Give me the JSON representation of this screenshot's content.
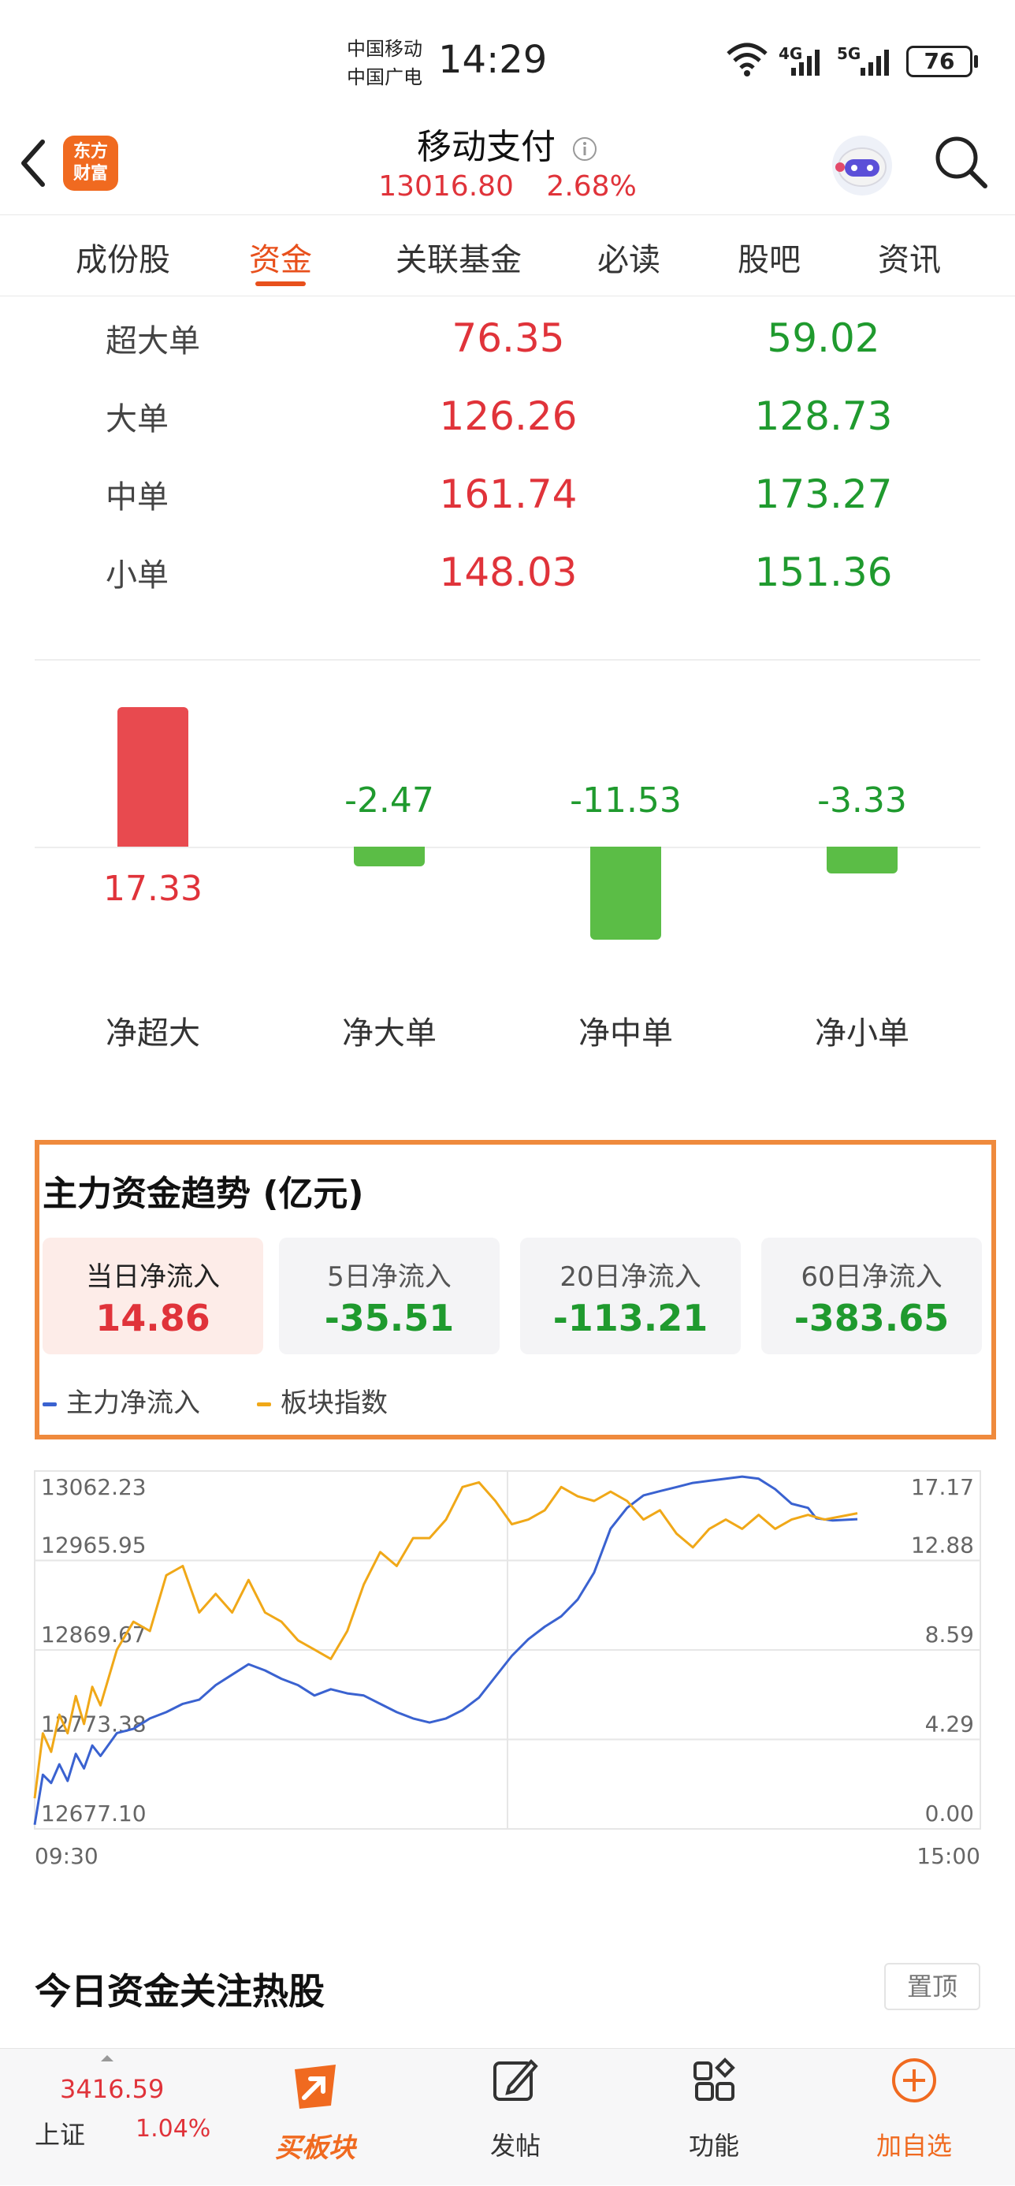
{
  "status_bar": {
    "carrier1": "中国移动",
    "carrier2": "中国广电",
    "time": "14:29",
    "network1": "4G",
    "network2": "5G",
    "battery": "76"
  },
  "header": {
    "logo_line1": "东方",
    "logo_line2": "财富",
    "title": "移动支付",
    "price": "13016.80",
    "change_pct": "2.68%"
  },
  "tabs": [
    {
      "label": "成份股"
    },
    {
      "label": "资金"
    },
    {
      "label": "关联基金"
    },
    {
      "label": "必读"
    },
    {
      "label": "股吧"
    },
    {
      "label": "资讯"
    }
  ],
  "active_tab": "资金",
  "flow_table": [
    {
      "label": "超大单",
      "inflow": "76.35",
      "outflow": "59.02"
    },
    {
      "label": "大单",
      "inflow": "126.26",
      "outflow": "128.73"
    },
    {
      "label": "中单",
      "inflow": "161.74",
      "outflow": "173.27"
    },
    {
      "label": "小单",
      "inflow": "148.03",
      "outflow": "151.36"
    }
  ],
  "net_bars": [
    {
      "label": "净超大",
      "value": 17.33,
      "display": "17.33"
    },
    {
      "label": "净大单",
      "value": -2.47,
      "display": "-2.47"
    },
    {
      "label": "净中单",
      "value": -11.53,
      "display": "-11.53"
    },
    {
      "label": "净小单",
      "value": -3.33,
      "display": "-3.33"
    }
  ],
  "trend": {
    "title": "主力资金趋势 (亿元)",
    "cards": [
      {
        "label": "当日净流入",
        "value": "14.86",
        "color": "#e0333a"
      },
      {
        "label": "5日净流入",
        "value": "-35.51",
        "color": "#1f9a2e"
      },
      {
        "label": "20日净流入",
        "value": "-113.21",
        "color": "#1f9a2e"
      },
      {
        "label": "60日净流入",
        "value": "-383.65",
        "color": "#1f9a2e"
      }
    ],
    "legend_main": "主力净流入",
    "legend_index": "板块指数"
  },
  "chart_data": {
    "type": "line",
    "x_start": "09:30",
    "x_end": "15:00",
    "left_ticks": [
      "13062.23",
      "12965.95",
      "12869.67",
      "12773.38",
      "12677.10"
    ],
    "right_ticks": [
      "17.17",
      "12.88",
      "8.59",
      "4.29",
      "0.00"
    ],
    "left_ylim": [
      12677.1,
      13062.23
    ],
    "right_ylim": [
      0.0,
      17.17
    ],
    "grid": true,
    "series": [
      {
        "name": "主力净流入",
        "axis": "right",
        "color": "#3a62d0",
        "points": [
          [
            0,
            0.2
          ],
          [
            0.01,
            2.6
          ],
          [
            0.02,
            2.2
          ],
          [
            0.03,
            3.1
          ],
          [
            0.04,
            2.3
          ],
          [
            0.05,
            3.6
          ],
          [
            0.06,
            2.9
          ],
          [
            0.07,
            4.0
          ],
          [
            0.08,
            3.5
          ],
          [
            0.1,
            4.6
          ],
          [
            0.12,
            4.8
          ],
          [
            0.14,
            5.3
          ],
          [
            0.16,
            5.6
          ],
          [
            0.18,
            6.0
          ],
          [
            0.2,
            6.2
          ],
          [
            0.22,
            6.9
          ],
          [
            0.24,
            7.4
          ],
          [
            0.26,
            7.9
          ],
          [
            0.28,
            7.6
          ],
          [
            0.3,
            7.2
          ],
          [
            0.32,
            6.9
          ],
          [
            0.34,
            6.4
          ],
          [
            0.36,
            6.7
          ],
          [
            0.38,
            6.5
          ],
          [
            0.4,
            6.4
          ],
          [
            0.42,
            6.0
          ],
          [
            0.44,
            5.6
          ],
          [
            0.46,
            5.3
          ],
          [
            0.48,
            5.1
          ],
          [
            0.5,
            5.3
          ],
          [
            0.52,
            5.7
          ],
          [
            0.54,
            6.3
          ],
          [
            0.56,
            7.3
          ],
          [
            0.58,
            8.3
          ],
          [
            0.6,
            9.1
          ],
          [
            0.62,
            9.7
          ],
          [
            0.64,
            10.2
          ],
          [
            0.66,
            11.0
          ],
          [
            0.68,
            12.3
          ],
          [
            0.7,
            14.4
          ],
          [
            0.72,
            15.4
          ],
          [
            0.74,
            16.0
          ],
          [
            0.76,
            16.2
          ],
          [
            0.78,
            16.4
          ],
          [
            0.8,
            16.6
          ],
          [
            0.82,
            16.7
          ],
          [
            0.84,
            16.8
          ],
          [
            0.86,
            16.9
          ],
          [
            0.88,
            16.8
          ],
          [
            0.9,
            16.3
          ],
          [
            0.92,
            15.6
          ],
          [
            0.94,
            15.4
          ],
          [
            0.95,
            14.9
          ],
          [
            0.97,
            14.8
          ],
          [
            1.0,
            14.86
          ]
        ]
      },
      {
        "name": "板块指数",
        "axis": "left",
        "color": "#f0a818",
        "points": [
          [
            0,
            12710
          ],
          [
            0.01,
            12780
          ],
          [
            0.02,
            12760
          ],
          [
            0.03,
            12800
          ],
          [
            0.04,
            12780
          ],
          [
            0.05,
            12820
          ],
          [
            0.06,
            12790
          ],
          [
            0.07,
            12830
          ],
          [
            0.08,
            12810
          ],
          [
            0.1,
            12870
          ],
          [
            0.12,
            12900
          ],
          [
            0.14,
            12890
          ],
          [
            0.16,
            12950
          ],
          [
            0.18,
            12960
          ],
          [
            0.2,
            12910
          ],
          [
            0.22,
            12930
          ],
          [
            0.24,
            12910
          ],
          [
            0.26,
            12945
          ],
          [
            0.28,
            12910
          ],
          [
            0.3,
            12900
          ],
          [
            0.32,
            12880
          ],
          [
            0.34,
            12870
          ],
          [
            0.36,
            12860
          ],
          [
            0.38,
            12890
          ],
          [
            0.4,
            12940
          ],
          [
            0.42,
            12975
          ],
          [
            0.44,
            12960
          ],
          [
            0.46,
            12990
          ],
          [
            0.48,
            12990
          ],
          [
            0.5,
            13010
          ],
          [
            0.52,
            13045
          ],
          [
            0.54,
            13050
          ],
          [
            0.56,
            13030
          ],
          [
            0.58,
            13005
          ],
          [
            0.6,
            13010
          ],
          [
            0.62,
            13020
          ],
          [
            0.64,
            13045
          ],
          [
            0.66,
            13035
          ],
          [
            0.68,
            13030
          ],
          [
            0.7,
            13040
          ],
          [
            0.72,
            13030
          ],
          [
            0.74,
            13010
          ],
          [
            0.76,
            13020
          ],
          [
            0.78,
            12995
          ],
          [
            0.8,
            12980
          ],
          [
            0.82,
            13000
          ],
          [
            0.84,
            13010
          ],
          [
            0.86,
            13000
          ],
          [
            0.88,
            13015
          ],
          [
            0.9,
            13000
          ],
          [
            0.92,
            13010
          ],
          [
            0.94,
            13015
          ],
          [
            0.96,
            13010
          ],
          [
            1.0,
            13016.8
          ]
        ]
      }
    ]
  },
  "hot_section": {
    "title": "今日资金关注热股",
    "pin_label": "置顶"
  },
  "bottom_bar": {
    "index_value": "3416.59",
    "index_name": "上证",
    "index_change": "1.04%",
    "buy_sector": "买板块",
    "post": "发帖",
    "function": "功能",
    "add_watch": "加自选"
  },
  "colors": {
    "up": "#e0333a",
    "down": "#1f9a2e",
    "accent": "#e8501c",
    "highlight_border": "#ef8a3d"
  }
}
